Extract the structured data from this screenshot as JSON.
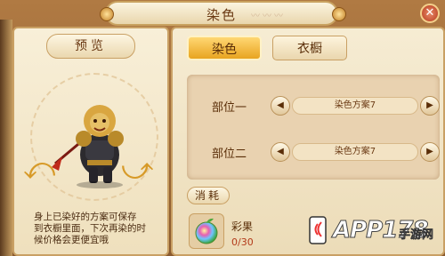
{
  "window": {
    "title": "染色",
    "close_label": "✕"
  },
  "preview": {
    "tab_label": "预览",
    "hint": "身上已染好的方案可保存\n到衣橱里面，下次再染的时\n候价格会更便宜哦",
    "rotate_left_icon": "rotate-left-icon",
    "rotate_right_icon": "rotate-right-icon"
  },
  "tabs": [
    {
      "label": "染色",
      "active": true
    },
    {
      "label": "衣橱",
      "active": false
    }
  ],
  "parts": [
    {
      "label": "部位一",
      "scheme": "染色方案7"
    },
    {
      "label": "部位二",
      "scheme": "染色方案7"
    }
  ],
  "consume": {
    "label": "消耗",
    "item_name": "彩果",
    "item_count": "0/30"
  },
  "watermark": {
    "brand": "APP178",
    "sub": "手游网"
  }
}
